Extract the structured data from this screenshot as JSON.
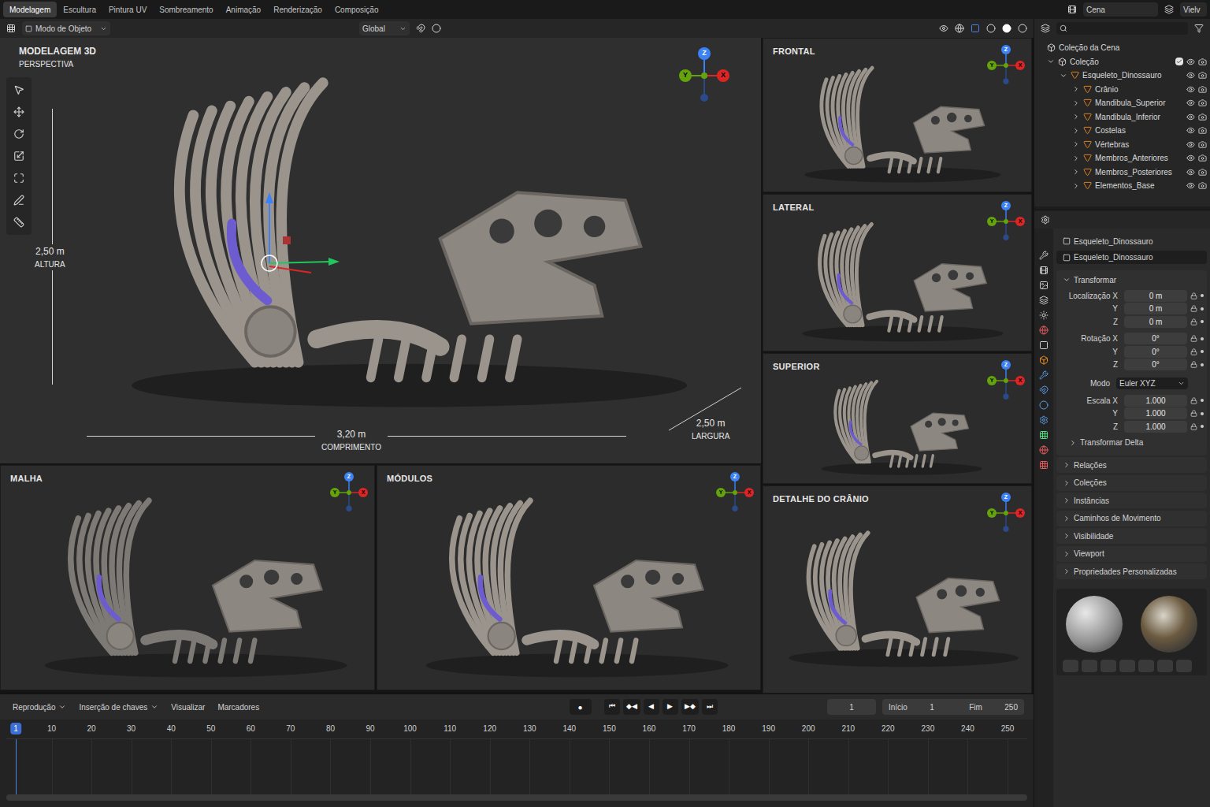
{
  "menu": {
    "tabs": [
      {
        "label": "Modelagem",
        "selected": true
      },
      {
        "label": "Escultura",
        "selected": false
      },
      {
        "label": "Pintura UV",
        "selected": false
      },
      {
        "label": "Sombreamento",
        "selected": false
      },
      {
        "label": "Animação",
        "selected": false
      },
      {
        "label": "Renderização",
        "selected": false
      },
      {
        "label": "Composição",
        "selected": false
      }
    ],
    "scene": "Cena",
    "view_layer": "Vielv"
  },
  "toolbar": {
    "mode": "Modo de Objeto",
    "orientation": "Global"
  },
  "axes": {
    "x": "X",
    "y": "Y",
    "z": "Z"
  },
  "main_viewport": {
    "title": "MODELAGEM 3D",
    "subtitle": "PERSPECTIVA",
    "height": {
      "value": "2,50 m",
      "label": "ALTURA"
    },
    "length": {
      "value": "3,20 m",
      "label": "COMPRIMENTO"
    },
    "width": {
      "value": "2,50 m",
      "label": "LARGURA"
    }
  },
  "side_viewports": [
    {
      "title": "FRONTAL"
    },
    {
      "title": "LATERAL"
    },
    {
      "title": "SUPERIOR"
    },
    {
      "title": "DETALHE DO CRÂNIO"
    }
  ],
  "bottom_viewports": [
    {
      "title": "MALHA"
    },
    {
      "title": "MÓDULOS"
    }
  ],
  "outliner": {
    "root": "Coleção da Cena",
    "collection": "Coleção",
    "collection_checked": true,
    "object": "Esqueleto_Dinossauro",
    "children": [
      "Crânio",
      "Mandibula_Superior",
      "Mandibula_Inferior",
      "Costelas",
      "Vértebras",
      "Membros_Anteriores",
      "Membros_Posteriores",
      "Elementos_Base"
    ]
  },
  "properties": {
    "object": "Esqueleto_Dinossauro",
    "datablock": "Esqueleto_Dinossauro",
    "section": "Transformar",
    "groups": [
      {
        "label": "Localização",
        "rows": [
          {
            "axis": "X",
            "value": "0 m"
          },
          {
            "axis": "Y",
            "value": "0 m"
          },
          {
            "axis": "Z",
            "value": "0 m"
          }
        ]
      },
      {
        "label": "Rotação",
        "rows": [
          {
            "axis": "X",
            "value": "0°"
          },
          {
            "axis": "Y",
            "value": "0°"
          },
          {
            "axis": "Z",
            "value": "0°"
          }
        ]
      }
    ],
    "mode_label": "Modo",
    "mode_value": "Euler XYZ",
    "scale": {
      "label": "Escala",
      "rows": [
        {
          "axis": "X",
          "value": "1.000"
        },
        {
          "axis": "Y",
          "value": "1.000"
        },
        {
          "axis": "Z",
          "value": "1.000"
        }
      ]
    },
    "delta": "Transformar Delta",
    "sections": [
      "Relações",
      "Coleções",
      "Instâncias",
      "Caminhos de Movimento",
      "Visibilidade",
      "Viewport",
      "Propriedades Personalizadas"
    ]
  },
  "timeline": {
    "menus": [
      "Reprodução",
      "Inserção de chaves",
      "Visualizar",
      "Marcadores"
    ],
    "record": "●",
    "controls": [
      "⏮",
      "◆◀",
      "◀",
      "▶",
      "▶◆",
      "⏭"
    ],
    "current": "1",
    "start_label": "Início",
    "start": "1",
    "end_label": "Fim",
    "end": "250",
    "ticks": [
      "1",
      "10",
      "20",
      "30",
      "40",
      "50",
      "60",
      "70",
      "80",
      "90",
      "100",
      "110",
      "120",
      "130",
      "140",
      "150",
      "160",
      "170",
      "180",
      "190",
      "200",
      "210",
      "220",
      "230",
      "240",
      "250"
    ]
  }
}
